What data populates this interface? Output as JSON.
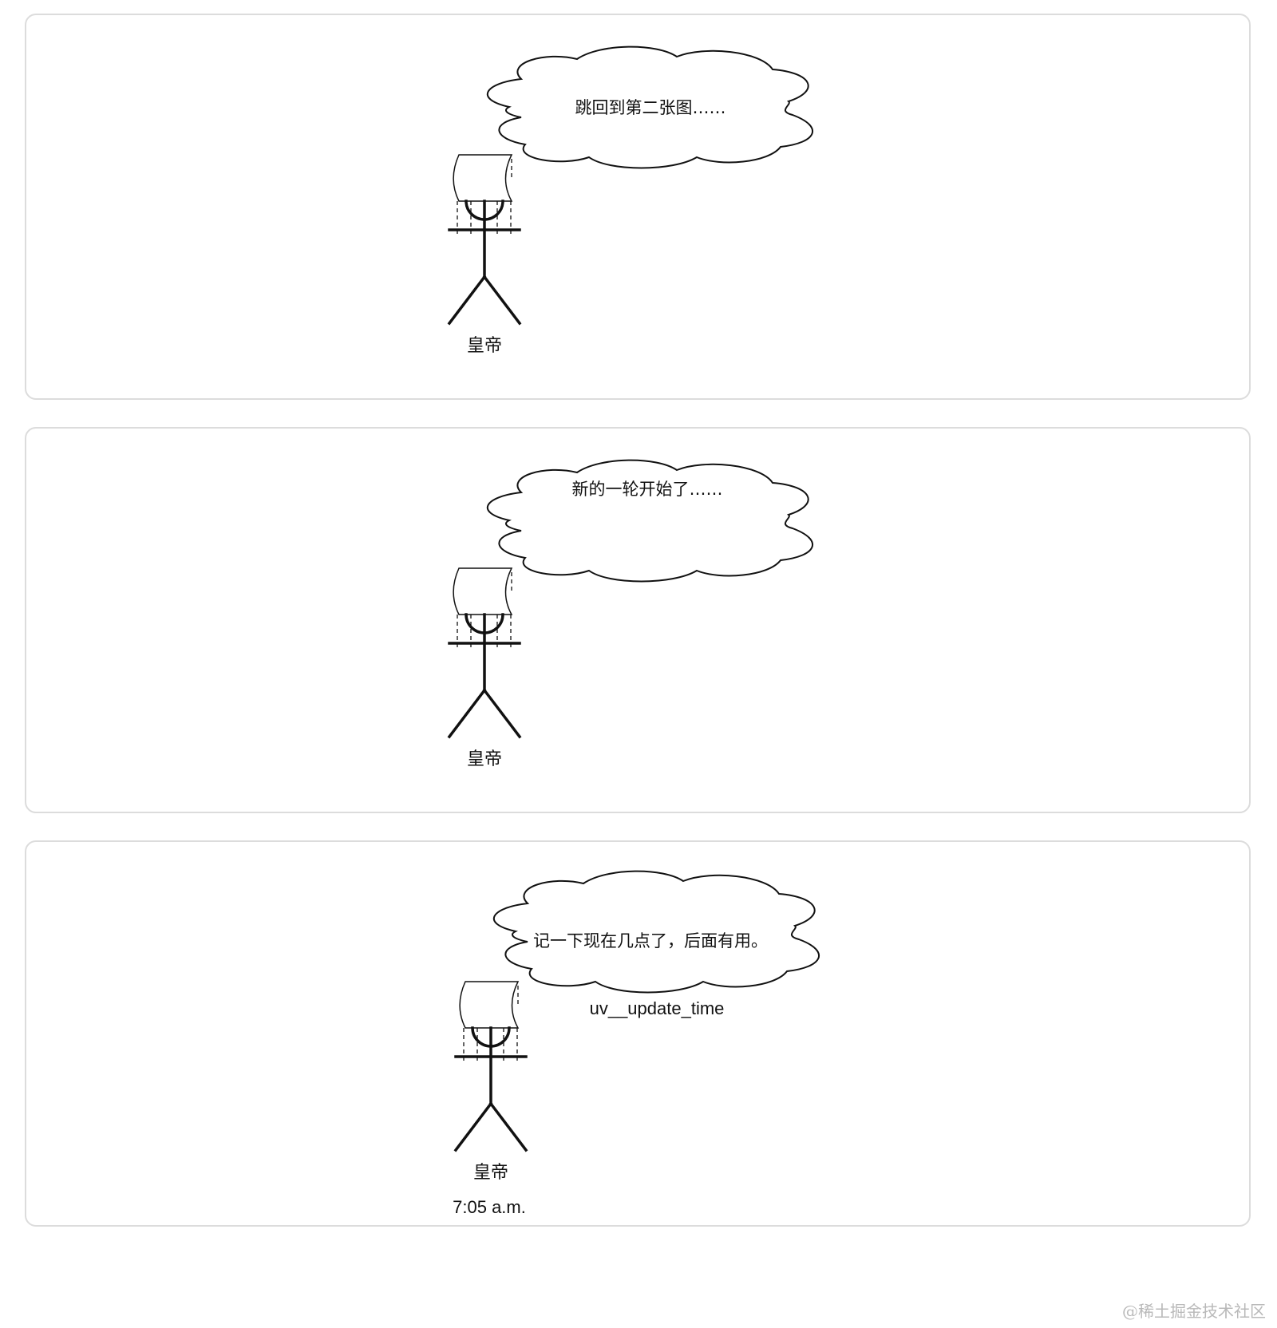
{
  "panels": [
    {
      "thought": "跳回到第二张图……",
      "figure_label": "皇帝"
    },
    {
      "thought": "新的一轮开始了……",
      "figure_label": "皇帝"
    },
    {
      "thought": "记一下现在几点了，后面有用。",
      "figure_label": "皇帝",
      "variable_label": "uv__update_time",
      "time_label": "7:05 a.m."
    }
  ],
  "watermark": "@稀土掘金技术社区",
  "icons": [
    "cloud-icon",
    "emperor-figure-icon",
    "crown-icon"
  ]
}
